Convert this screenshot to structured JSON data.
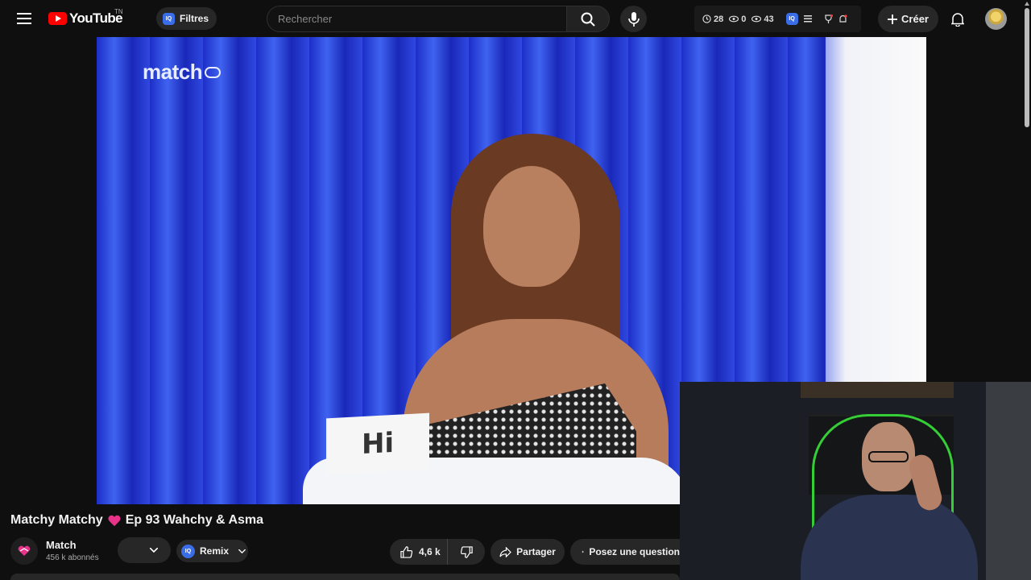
{
  "header": {
    "logo_text": "YouTube",
    "country_code": "TN",
    "filters_label": "Filtres",
    "search_placeholder": "Rechercher",
    "stats": [
      {
        "icon": "clock-icon",
        "value": "28"
      },
      {
        "icon": "eye-icon",
        "value": "0"
      },
      {
        "icon": "eye-icon",
        "value": "43"
      }
    ],
    "create_label": "Créer"
  },
  "player": {
    "brand_watermark": "match",
    "name_card": "Hi"
  },
  "video": {
    "title_prefix": "Matchy Matchy",
    "title_suffix": "Ep 93 Wahchy & Asma",
    "channel_name": "Match",
    "subscribers": "456 k abonnés",
    "remix_label": "Remix",
    "likes": "4,6 k",
    "share_label": "Partager",
    "ask_label": "Posez une question"
  },
  "colors": {
    "accent_red": "#ff0000",
    "iq_blue": "#3a6ee8",
    "chip_bg": "#272727"
  }
}
